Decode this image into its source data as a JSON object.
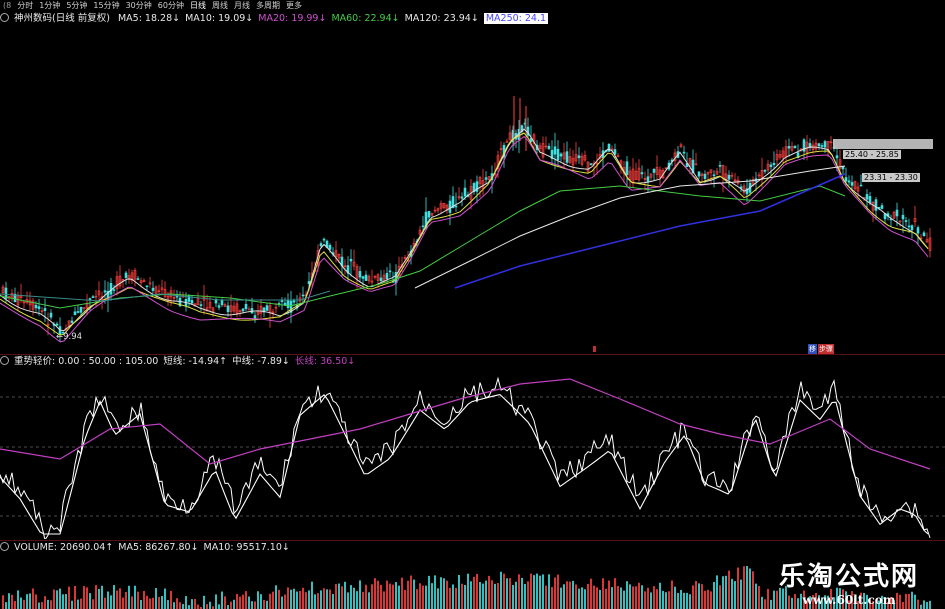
{
  "toolbar": {
    "lead": "(8",
    "items": [
      "分时",
      "1分钟",
      "5分钟",
      "15分钟",
      "30分钟",
      "60分钟",
      "日线",
      "周线",
      "月线",
      "多周期",
      "更多"
    ],
    "active_index": 6
  },
  "main": {
    "title": "神州数码(日线 前复权)",
    "indicators": [
      {
        "label": "MA5: 18.28↓",
        "color": "#e8e8e8"
      },
      {
        "label": "MA10: 19.09↓",
        "color": "#e8e8e8"
      },
      {
        "label": "MA20: 19.99↓",
        "color": "#d050d0"
      },
      {
        "label": "MA60: 22.94↓",
        "color": "#44cc44"
      },
      {
        "label": "MA120: 23.94↓",
        "color": "#e8e8e8"
      },
      {
        "label": "MA250: 24.1",
        "color": "#4444ff"
      }
    ],
    "low_label": "←9.94",
    "tag1": "25.40 - 25.85",
    "tag2": "23.31 - 23.30",
    "markers": [
      "移",
      "步骤"
    ]
  },
  "osc": {
    "name": "重势轻价",
    "params": ": 0.00 : 50.00 : 105.00",
    "short_label": "短线: -14.94↑",
    "mid_label": "中线: -7.89↓",
    "long_label": "长线: 36.50↓",
    "colors": {
      "short": "#ffffff",
      "mid": "#ffffff",
      "long": "#c040c0"
    }
  },
  "volume": {
    "label": "VOLUME: 20690.04↑",
    "ma5": "MA5: 86267.80↓",
    "ma10": "MA10: 95517.10↓"
  },
  "watermark": {
    "cn": "乐淘公式网",
    "url": "www.60lt.com"
  }
}
